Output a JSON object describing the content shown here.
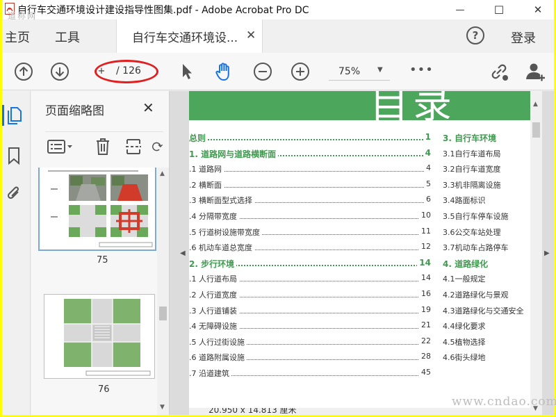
{
  "window": {
    "title": "自行车交通环境设计建设指导性图集.pdf - Adobe Acrobat Pro DC",
    "watermark_top": "道称网",
    "minimize": "—",
    "maximize": "☐",
    "close": "✕"
  },
  "tabs": {
    "home": "主页",
    "tools": "工具",
    "document": "自行车交通环境设...",
    "document_close": "✕",
    "help": "?",
    "sign_in": "登录"
  },
  "toolbar": {
    "page_current": "+",
    "page_total": "/ 126",
    "zoom": "75%",
    "zoom_arrow": "▼",
    "more": "•••"
  },
  "panel": {
    "title": "页面缩略图",
    "close": "✕",
    "thumbnails": [
      {
        "number": "75"
      },
      {
        "number": "76"
      }
    ]
  },
  "document": {
    "banner_text": "目录",
    "toc_left": [
      {
        "label": "总则",
        "page": "1",
        "section": true
      },
      {
        "label": "1. 道路网与道路横断面",
        "page": "4",
        "section": true
      },
      {
        "label": ".1 道路网",
        "page": "4",
        "section": false
      },
      {
        "label": ".2 横断面",
        "page": "5",
        "section": false
      },
      {
        "label": ".3 横断面型式选择",
        "page": "6",
        "section": false
      },
      {
        "label": ".4 分隔带宽度",
        "page": "10",
        "section": false
      },
      {
        "label": ".5 行道树设施带宽度",
        "page": "11",
        "section": false
      },
      {
        "label": ".6 机动车道总宽度",
        "page": "12",
        "section": false
      },
      {
        "label": "2. 步行环境",
        "page": "14",
        "section": true
      },
      {
        "label": ".1 人行道布局",
        "page": "14",
        "section": false
      },
      {
        "label": ".2 人行道宽度",
        "page": "16",
        "section": false
      },
      {
        "label": ".3 人行道铺装",
        "page": "19",
        "section": false
      },
      {
        "label": ".4 无障碍设施",
        "page": "21",
        "section": false
      },
      {
        "label": ".5 人行过街设施",
        "page": "22",
        "section": false
      },
      {
        "label": ".6 道路附属设施",
        "page": "28",
        "section": false
      },
      {
        "label": ".7 沿道建筑",
        "page": "45",
        "section": false
      }
    ],
    "toc_right": [
      {
        "label": "3. 自行车环境",
        "section": true
      },
      {
        "label": "3.1自行车道布局",
        "section": false
      },
      {
        "label": "3.2自行车道宽度",
        "section": false
      },
      {
        "label": "3.3机非隔离设施",
        "section": false
      },
      {
        "label": "3.4路面标识",
        "section": false
      },
      {
        "label": "3.5自行车停车设施",
        "section": false
      },
      {
        "label": "3.6公交车站处理",
        "section": false
      },
      {
        "label": "3.7机动车占路停车",
        "section": false
      },
      {
        "label": "4. 道路绿化",
        "section": true
      },
      {
        "label": "4.1一般规定",
        "section": false
      },
      {
        "label": "4.2道路绿化与景观",
        "section": false
      },
      {
        "label": "4.3道路绿化与交通安全",
        "section": false
      },
      {
        "label": "4.4绿化要求",
        "section": false
      },
      {
        "label": "4.5植物选择",
        "section": false
      },
      {
        "label": "4.6街头绿地",
        "section": false
      }
    ],
    "page_size": "20.950 x 14.813 厘米"
  },
  "watermark_bottom": "www.cndao.com",
  "colors": {
    "green": "#4ca65c",
    "toc_green": "#3f9a4f",
    "blue": "#1473e6",
    "annotation_red": "#e02020",
    "frame_yellow": "#ffff00"
  }
}
